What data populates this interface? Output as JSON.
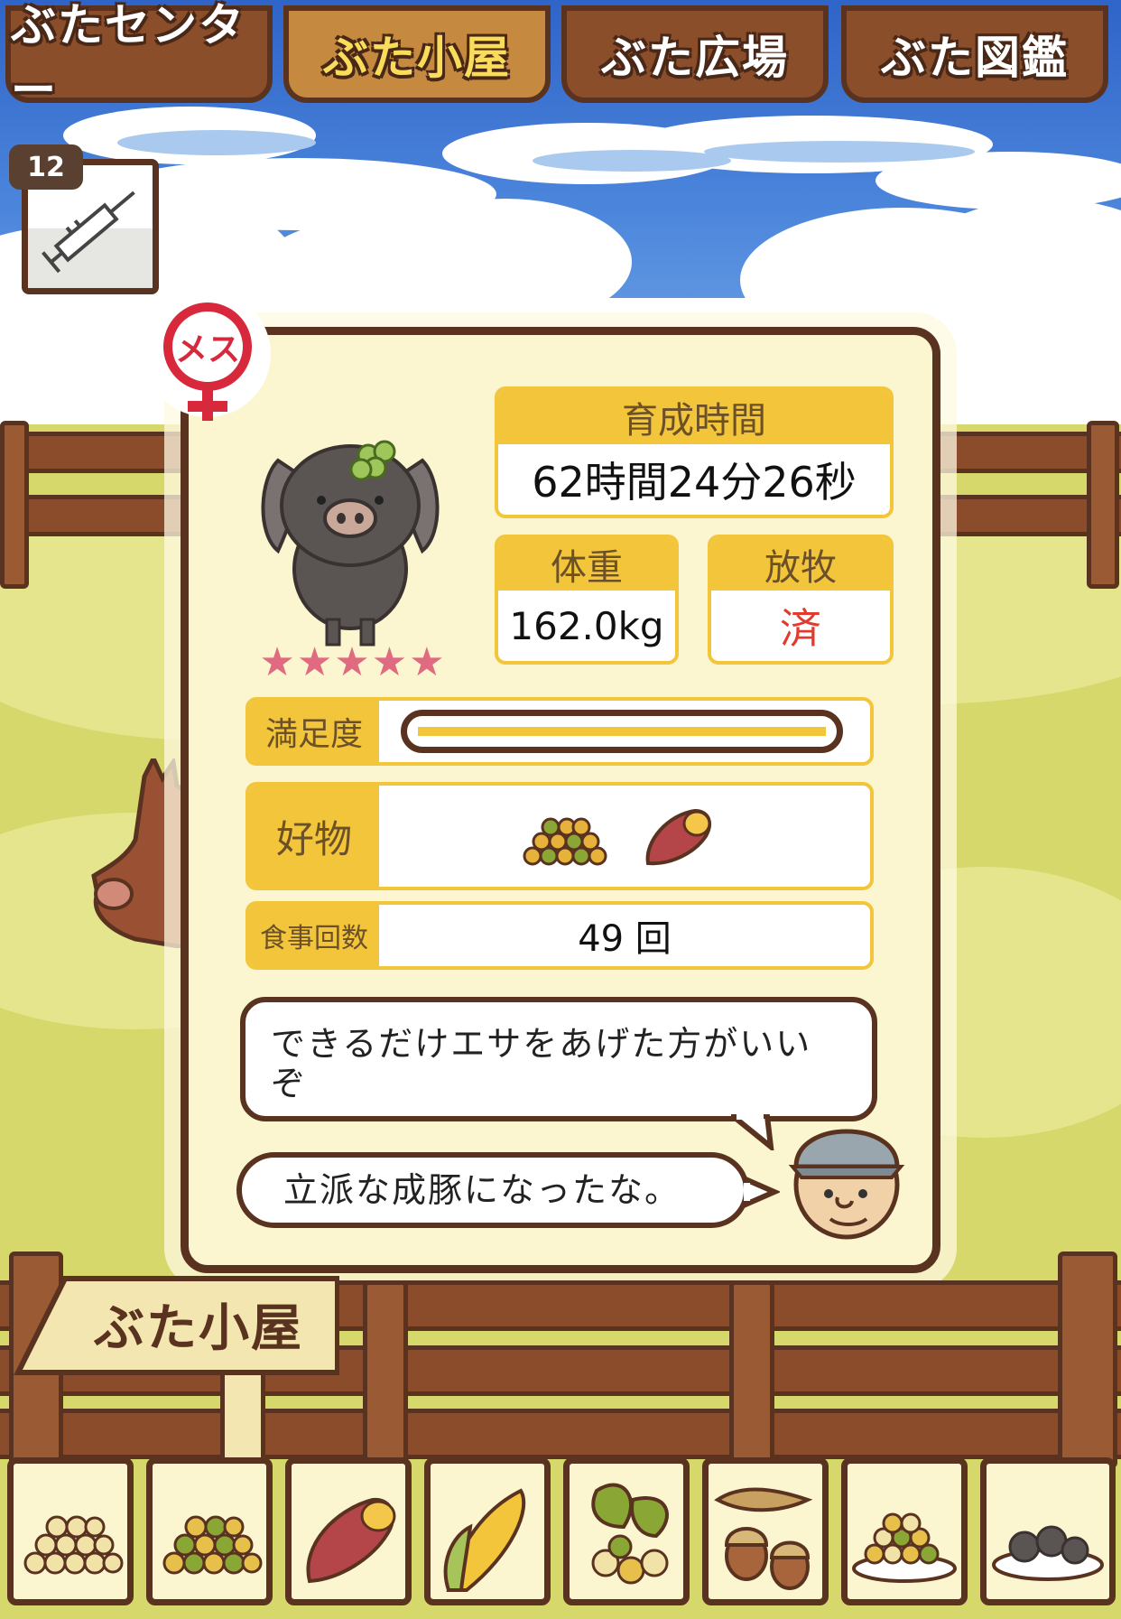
{
  "tabs": [
    {
      "label": "ぶたセンター",
      "active": false
    },
    {
      "label": "ぶた小屋",
      "active": true
    },
    {
      "label": "ぶた広場",
      "active": false
    },
    {
      "label": "ぶた図鑑",
      "active": false
    }
  ],
  "items": {
    "syringe_count": "12"
  },
  "pig": {
    "gender_label": "メス",
    "stars": "★★★★★",
    "rating": 5,
    "growth_time_label": "育成時間",
    "growth_time_value": "62時間24分26秒",
    "weight_label": "体重",
    "weight_value": "162.0kg",
    "grazing_label": "放牧",
    "grazing_value": "済",
    "satisfaction_label": "満足度",
    "satisfaction_level": 1.0,
    "favorite_label": "好物",
    "favorite_foods": [
      "beans-icon",
      "sweet-potato-icon"
    ],
    "meal_count_label": "食事回数",
    "meal_count_value": "49 回"
  },
  "dialogue": {
    "advice": "できるだけエサをあげた方がいいぞ",
    "comment": "立派な成豚になったな。"
  },
  "sign": {
    "label": "ぶた小屋"
  },
  "foods": [
    "mixed-grain-icon",
    "green-grain-icon",
    "sweet-potato-icon",
    "corn-icon",
    "nut-leaf-icon",
    "acorn-icon",
    "grain-plate-icon",
    "meatball-plate-icon"
  ],
  "colors": {
    "accent": "#f2c53a",
    "wood_dark": "#5a3220",
    "female_red": "#d7283c",
    "grazing_done": "#e23a2c"
  }
}
